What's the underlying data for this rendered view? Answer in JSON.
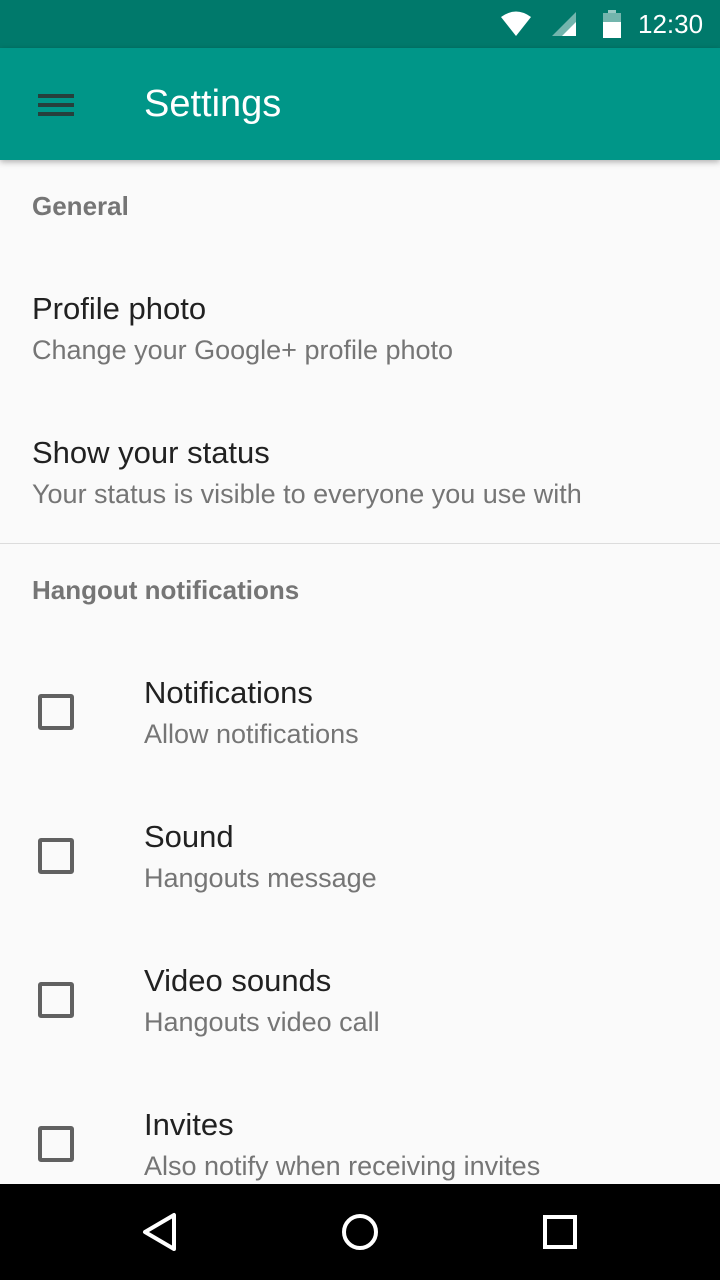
{
  "status_bar": {
    "time": "12:30",
    "icons": [
      "wifi-icon",
      "cell-signal-icon",
      "battery-icon"
    ]
  },
  "toolbar": {
    "title": "Settings",
    "menu_icon": "hamburger-menu-icon"
  },
  "sections": {
    "general": {
      "header": "General",
      "items": [
        {
          "title": "Profile photo",
          "summary": "Change your Google+ profile photo"
        },
        {
          "title": "Show your status",
          "summary": "Your status is visible to everyone you use with"
        }
      ]
    },
    "hangout_notifications": {
      "header": "Hangout notifications",
      "items": [
        {
          "title": "Notifications",
          "summary": "Allow notifications",
          "checked": false
        },
        {
          "title": "Sound",
          "summary": "Hangouts message",
          "checked": false
        },
        {
          "title": "Video sounds",
          "summary": "Hangouts video call",
          "checked": false
        },
        {
          "title": "Invites",
          "summary": "Also notify when receiving invites",
          "checked": false
        }
      ]
    }
  },
  "nav_bar": {
    "icons": [
      "back-icon",
      "home-icon",
      "recents-icon"
    ]
  },
  "colors": {
    "status_bar": "#00796b",
    "toolbar": "#009688",
    "background": "#fafafa",
    "primary_text": "#212121",
    "secondary_text": "#757575"
  }
}
